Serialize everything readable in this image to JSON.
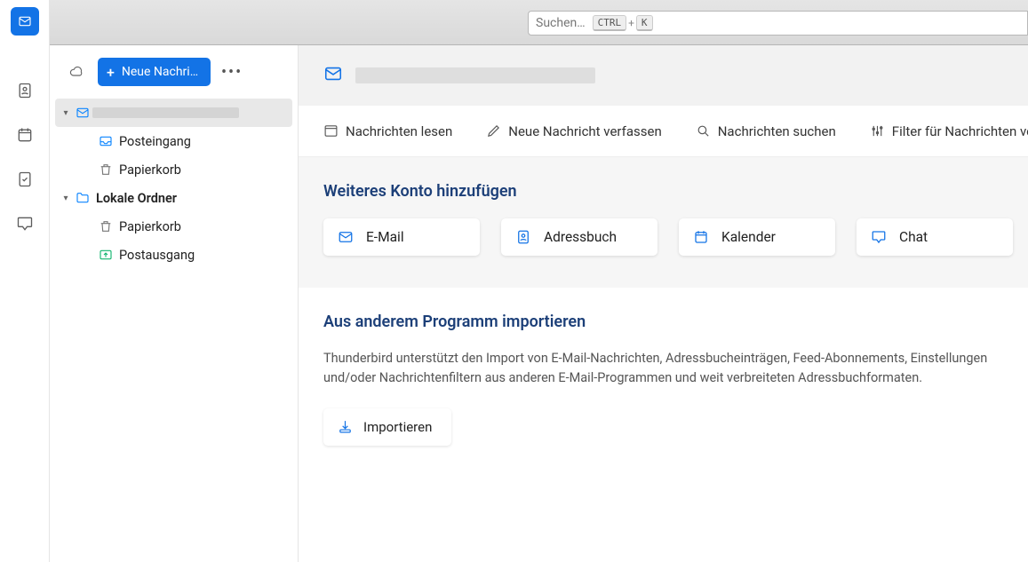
{
  "topbar": {
    "search_placeholder": "Suchen…",
    "kbd1": "CTRL",
    "kbd_plus": "+",
    "kbd2": "K"
  },
  "folder_pane": {
    "new_message": "Neue Nachri…",
    "account_name": "",
    "inbox": "Posteingang",
    "trash": "Papierkorb",
    "local_folders": "Lokale Ordner",
    "local_trash": "Papierkorb",
    "outbox": "Postausgang"
  },
  "main": {
    "actions": {
      "read": "Nachrichten lesen",
      "compose": "Neue Nachricht verfassen",
      "search": "Nachrichten suchen",
      "filter": "Filter für Nachrichten ver"
    },
    "add_account": {
      "title": "Weiteres Konto hinzufügen",
      "email": "E-Mail",
      "addressbook": "Adressbuch",
      "calendar": "Kalender",
      "chat": "Chat"
    },
    "import": {
      "title": "Aus anderem Programm importieren",
      "desc": "Thunderbird unterstützt den Import von E-Mail-Nachrichten, Adressbucheinträgen, Feed-Abonnements, Einstellungen und/oder Nachrichtenfiltern aus anderen E-Mail-Programmen und weit verbreiteten Adressbuchformaten.",
      "button": "Importieren"
    }
  }
}
